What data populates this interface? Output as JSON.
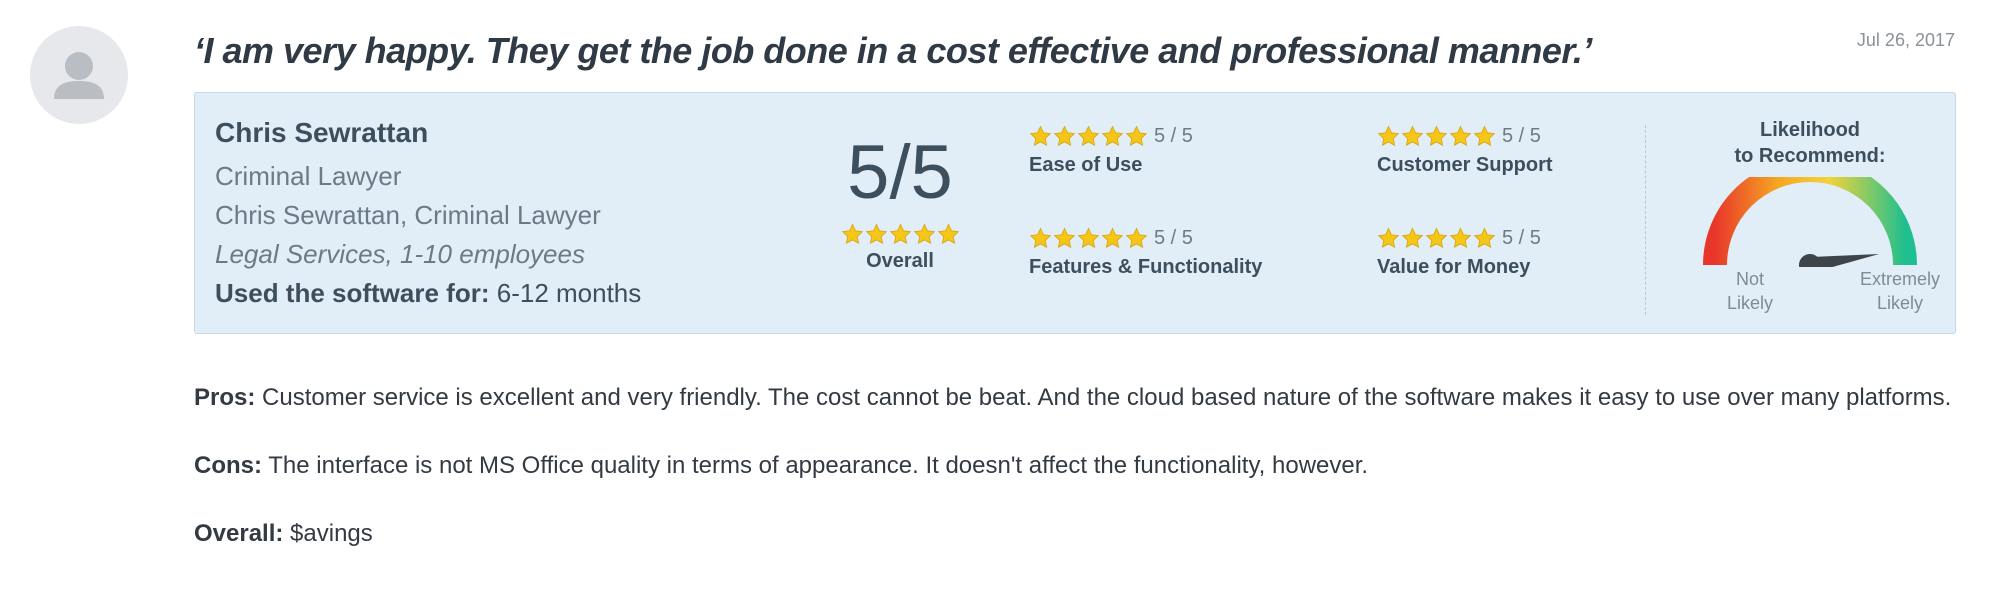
{
  "review": {
    "headline": "‘I am very happy. They get the job done in a cost effective and professional manner.’",
    "date": "Jul 26, 2017",
    "avatar_icon": "user-silhouette-icon"
  },
  "reviewer": {
    "name": "Chris Sewrattan",
    "title": "Criminal Lawyer",
    "company": "Chris Sewrattan, Criminal Lawyer",
    "industry": "Legal Services, 1-10 employees",
    "usage_label": "Used the software for:",
    "usage_value": "6-12 months"
  },
  "ratings": {
    "overall": {
      "score": "5/5",
      "stars": 5,
      "label": "Overall"
    },
    "ease_of_use": {
      "score": "5 / 5",
      "stars": 5,
      "label": "Ease of Use"
    },
    "customer_support": {
      "score": "5 / 5",
      "stars": 5,
      "label": "Customer Support"
    },
    "features": {
      "score": "5 / 5",
      "stars": 5,
      "label": "Features & Functionality"
    },
    "value": {
      "score": "5 / 5",
      "stars": 5,
      "label": "Value for Money"
    },
    "star_color": "#f5c518"
  },
  "likelihood": {
    "title_line1": "Likelihood",
    "title_line2": "to Recommend:",
    "min_line1": "Not",
    "min_line2": "Likely",
    "max_line1": "Extremely",
    "max_line2": "Likely",
    "level_fraction": 0.95,
    "colors": [
      "#e8372a",
      "#f5a623",
      "#f2d33a",
      "#1fbf8f"
    ]
  },
  "body": {
    "pros_label": "Pros:",
    "pros_text": " Customer service is excellent and very friendly. The cost cannot be beat. And the cloud based nature of the software makes it easy to use over many platforms.",
    "cons_label": "Cons:",
    "cons_text": " The interface is not MS Office quality in terms of appearance. It doesn't affect the functionality, however.",
    "overall_label": "Overall:",
    "overall_text": " $avings"
  }
}
